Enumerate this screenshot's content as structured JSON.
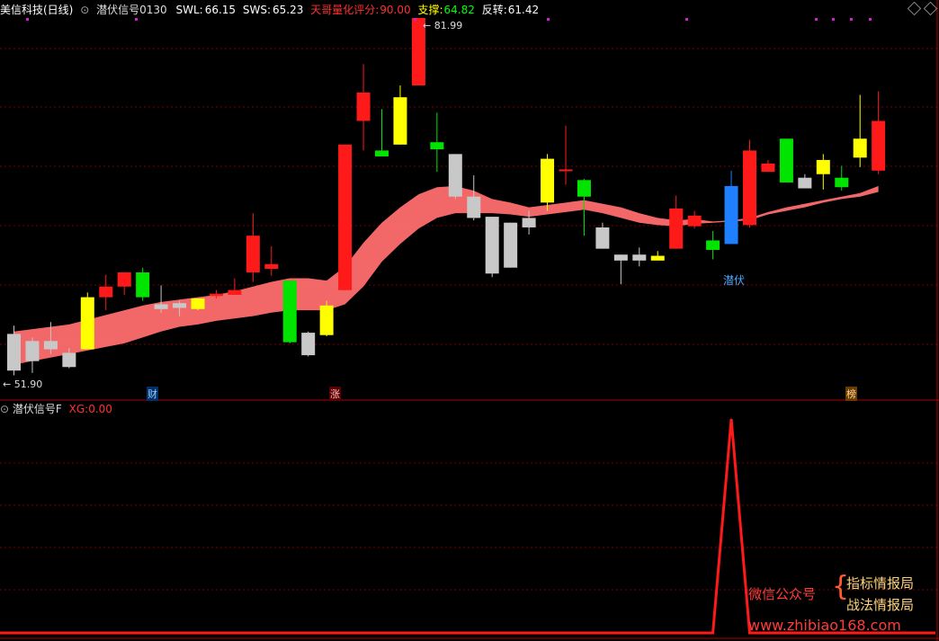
{
  "header": {
    "stock": "美信科技(日线)",
    "indicator": "潜伏信号0130",
    "swl_label": "SWL:",
    "swl_value": "66.15",
    "sws_label": "SWS:",
    "sws_value": "65.23",
    "score_label": "天哥量化评分:",
    "score_value": "90.00",
    "support_label": "支撑:",
    "support_value": "64.82",
    "reverse_label": "反转:",
    "reverse_value": "61.42"
  },
  "subpanel": {
    "title": "潜伏信号F",
    "xg_label": "XG:",
    "xg_value": "0.00"
  },
  "tags": {
    "cai": "财",
    "zhang": "涨",
    "bang": "榜"
  },
  "signal_label": "潜伏",
  "watermark": {
    "left": "微信公众号",
    "right1": "指标情报局",
    "right2": "战法情报局",
    "url": "www.zhibiao168.com"
  },
  "colors": {
    "up": "#ff1a1a",
    "down": "#00e400",
    "yellow": "#ffff00",
    "gray": "#c8c8c8",
    "blue": "#1e7fff",
    "band": "#ff6e6e",
    "grid": "#7a0000"
  },
  "chart_data": {
    "type": "candlestick",
    "price_range": [
      51.9,
      81.99
    ],
    "max_label": "81.99",
    "min_label": "51.90",
    "candles": [
      {
        "o": 55.8,
        "h": 56.5,
        "l": 52.3,
        "c": 52.7,
        "color": "gray"
      },
      {
        "o": 53.5,
        "h": 55.5,
        "l": 52.5,
        "c": 55.2,
        "color": "gray"
      },
      {
        "o": 55.2,
        "h": 56.8,
        "l": 54.1,
        "c": 54.5,
        "color": "gray"
      },
      {
        "o": 53.0,
        "h": 54.6,
        "l": 52.9,
        "c": 54.2,
        "color": "gray"
      },
      {
        "o": 54.5,
        "h": 59.3,
        "l": 54.5,
        "c": 58.9,
        "color": "yellow"
      },
      {
        "o": 58.9,
        "h": 60.8,
        "l": 57.8,
        "c": 59.8,
        "color": "red"
      },
      {
        "o": 59.8,
        "h": 61.0,
        "l": 59.1,
        "c": 61.0,
        "color": "red"
      },
      {
        "o": 61.0,
        "h": 61.4,
        "l": 58.6,
        "c": 58.9,
        "color": "green"
      },
      {
        "o": 58.3,
        "h": 59.9,
        "l": 57.6,
        "c": 57.9,
        "color": "gray"
      },
      {
        "o": 58.4,
        "h": 58.6,
        "l": 57.3,
        "c": 58.0,
        "color": "gray"
      },
      {
        "o": 58.8,
        "h": 58.8,
        "l": 57.8,
        "c": 57.9,
        "color": "yellow"
      },
      {
        "o": 59.0,
        "h": 59.5,
        "l": 58.8,
        "c": 59.2,
        "color": "red"
      },
      {
        "o": 59.1,
        "h": 60.5,
        "l": 59.1,
        "c": 59.5,
        "color": "red"
      },
      {
        "o": 61.0,
        "h": 66.0,
        "l": 60.2,
        "c": 64.1,
        "color": "red"
      },
      {
        "o": 61.3,
        "h": 63.2,
        "l": 60.7,
        "c": 61.7,
        "color": "red"
      },
      {
        "o": 60.3,
        "h": 60.3,
        "l": 55.0,
        "c": 55.1,
        "color": "green"
      },
      {
        "o": 55.9,
        "h": 56.0,
        "l": 53.9,
        "c": 54.0,
        "color": "gray"
      },
      {
        "o": 55.7,
        "h": 58.6,
        "l": 55.6,
        "c": 58.2,
        "color": "yellow"
      },
      {
        "o": 59.5,
        "h": 71.8,
        "l": 59.5,
        "c": 71.8,
        "color": "red"
      },
      {
        "o": 73.8,
        "h": 78.6,
        "l": 71.3,
        "c": 76.2,
        "color": "red"
      },
      {
        "o": 71.3,
        "h": 74.8,
        "l": 70.9,
        "c": 70.8,
        "color": "green"
      },
      {
        "o": 71.8,
        "h": 76.8,
        "l": 71.8,
        "c": 75.8,
        "color": "yellow"
      },
      {
        "o": 76.8,
        "h": 81.99,
        "l": 76.8,
        "c": 82.5,
        "color": "red"
      },
      {
        "o": 72.0,
        "h": 74.5,
        "l": 69.5,
        "c": 71.4,
        "color": "green"
      },
      {
        "o": 71.0,
        "h": 71.0,
        "l": 67.2,
        "c": 67.4,
        "color": "gray"
      },
      {
        "o": 67.4,
        "h": 69.2,
        "l": 65.4,
        "c": 65.6,
        "color": "gray"
      },
      {
        "o": 65.7,
        "h": 65.7,
        "l": 60.6,
        "c": 60.9,
        "color": "gray"
      },
      {
        "o": 65.2,
        "h": 65.2,
        "l": 61.6,
        "c": 61.4,
        "color": "gray"
      },
      {
        "o": 65.6,
        "h": 66.2,
        "l": 64.2,
        "c": 64.8,
        "color": "gray"
      },
      {
        "o": 66.9,
        "h": 71.0,
        "l": 66.2,
        "c": 70.6,
        "color": "yellow"
      },
      {
        "o": 69.7,
        "h": 73.4,
        "l": 68.4,
        "c": 69.7,
        "color": "red"
      },
      {
        "o": 68.8,
        "h": 68.9,
        "l": 64.1,
        "c": 67.4,
        "color": "green"
      },
      {
        "o": 64.8,
        "h": 65.2,
        "l": 63.0,
        "c": 63.0,
        "color": "gray"
      },
      {
        "o": 62.5,
        "h": 62.5,
        "l": 60.0,
        "c": 62.0,
        "color": "gray"
      },
      {
        "o": 62.5,
        "h": 63.1,
        "l": 61.5,
        "c": 62.0,
        "color": "gray"
      },
      {
        "o": 62.4,
        "h": 62.8,
        "l": 62.0,
        "c": 62.0,
        "color": "yellow"
      },
      {
        "o": 63.0,
        "h": 67.5,
        "l": 63.0,
        "c": 66.4,
        "color": "red"
      },
      {
        "o": 64.9,
        "h": 66.2,
        "l": 64.7,
        "c": 65.8,
        "color": "red"
      },
      {
        "o": 63.7,
        "h": 64.5,
        "l": 62.1,
        "c": 62.9,
        "color": "green"
      },
      {
        "o": 63.4,
        "h": 69.6,
        "l": 63.4,
        "c": 68.3,
        "color": "blue"
      },
      {
        "o": 65.0,
        "h": 72.2,
        "l": 64.8,
        "c": 71.3,
        "color": "red"
      },
      {
        "o": 69.5,
        "h": 70.5,
        "l": 69.5,
        "c": 70.2,
        "color": "red"
      },
      {
        "o": 72.3,
        "h": 72.3,
        "l": 68.6,
        "c": 68.6,
        "color": "green"
      },
      {
        "o": 69.0,
        "h": 69.3,
        "l": 68.2,
        "c": 68.1,
        "color": "gray"
      },
      {
        "o": 69.3,
        "h": 71.0,
        "l": 68.0,
        "c": 70.5,
        "color": "yellow"
      },
      {
        "o": 69.0,
        "h": 70.0,
        "l": 67.9,
        "c": 68.2,
        "color": "green"
      },
      {
        "o": 70.7,
        "h": 76.0,
        "l": 69.9,
        "c": 72.3,
        "color": "yellow"
      },
      {
        "o": 69.6,
        "h": 76.3,
        "l": 69.3,
        "c": 73.8,
        "color": "red"
      }
    ],
    "band_upper": [
      56.0,
      56.2,
      56.4,
      56.6,
      57.0,
      57.4,
      57.8,
      58.2,
      58.5,
      58.7,
      58.9,
      59.1,
      59.4,
      59.8,
      60.2,
      60.5,
      60.5,
      60.3,
      61.5,
      63.5,
      65.2,
      66.5,
      67.6,
      68.2,
      68.3,
      67.9,
      67.2,
      66.9,
      66.5,
      66.7,
      66.9,
      67.1,
      66.8,
      66.5,
      66.0,
      65.6,
      65.4,
      65.5,
      65.3,
      65.4,
      65.6,
      66.1,
      66.5,
      66.8,
      67.1,
      67.4,
      67.7,
      68.3
    ],
    "band_lower": [
      53.2,
      53.5,
      53.8,
      54.1,
      54.4,
      54.7,
      55.0,
      55.5,
      56.0,
      56.4,
      56.6,
      56.9,
      57.1,
      57.3,
      57.6,
      57.8,
      57.8,
      57.8,
      58.3,
      59.8,
      61.9,
      63.4,
      64.7,
      65.6,
      66.0,
      66.0,
      66.0,
      65.9,
      65.7,
      65.9,
      66.1,
      66.3,
      66.0,
      65.6,
      65.2,
      65.0,
      64.9,
      65.1,
      65.2,
      65.3,
      65.4,
      65.9,
      66.2,
      66.5,
      66.9,
      67.2,
      67.4,
      67.8
    ],
    "signal_series": {
      "name": "XG",
      "values": [
        0,
        0,
        0,
        0,
        0,
        0,
        0,
        0,
        0,
        0,
        0,
        0,
        0,
        0,
        0,
        0,
        0,
        0,
        0,
        0,
        0,
        0,
        0,
        0,
        0,
        0,
        0,
        0,
        0,
        0,
        0,
        0,
        0,
        0,
        0,
        0,
        0,
        0,
        0,
        1,
        0,
        0,
        0,
        0,
        0,
        0,
        0,
        0
      ]
    }
  }
}
